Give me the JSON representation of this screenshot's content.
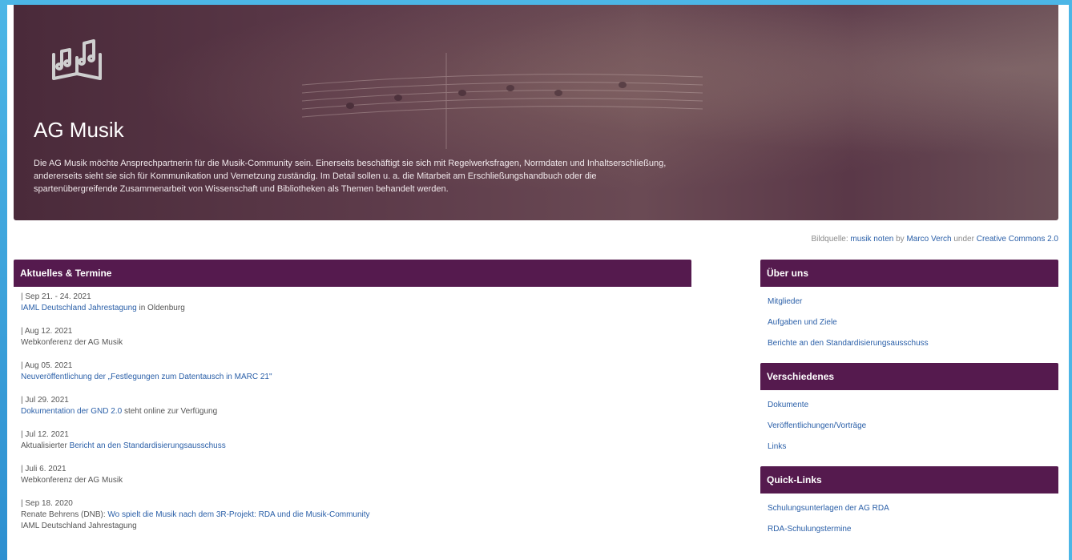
{
  "hero": {
    "title": "AG Musik",
    "description": "Die AG Musik möchte Ansprechpartnerin für die Musik-Community sein. Einerseits beschäftigt sie sich mit Regelwerksfragen, Normdaten und Inhaltserschließung, andererseits sieht sie sich für Kommunikation und Vernetzung zuständig. Im Detail sollen u. a. die Mitarbeit am Erschließungshandbuch oder die spartenübergreifende Zusammenarbeit von Wissenschaft und Bibliotheken als Themen behandelt werden.",
    "logo_icon": "music-book-icon"
  },
  "credit": {
    "prefix": "Bildquelle: ",
    "work": "musik noten",
    "by": " by ",
    "author": "Marco Verch",
    "under": " under ",
    "license": "Creative Commons 2.0"
  },
  "news": {
    "title": "Aktuelles & Termine",
    "items": [
      {
        "date": "| Sep 21. - 24. 2021",
        "pre": "",
        "link": "IAML Deutschland Jahrestagung",
        "post": " in Oldenburg",
        "extra": ""
      },
      {
        "date": "| Aug 12. 2021",
        "pre": "Webkonferenz der AG Musik",
        "link": "",
        "post": "",
        "extra": ""
      },
      {
        "date": "| Aug 05. 2021",
        "pre": "",
        "link": "Neuveröffentlichung der „Festlegungen zum Datentausch in MARC 21\"",
        "post": "",
        "extra": ""
      },
      {
        "date": "| Jul 29. 2021",
        "pre": "",
        "link": "Dokumentation der GND 2.0",
        "post": " steht online zur Verfügung",
        "extra": ""
      },
      {
        "date": "| Jul 12. 2021",
        "pre": "Aktualisierter ",
        "link": "Bericht an den Standardisierungsausschuss",
        "post": "",
        "extra": ""
      },
      {
        "date": "| Juli 6. 2021",
        "pre": "Webkonferenz der AG Musik",
        "link": "",
        "post": "",
        "extra": ""
      },
      {
        "date": "| Sep 18. 2020",
        "pre": "Renate Behrens (DNB): ",
        "link": "Wo spielt die Musik nach dem 3R-Projekt: RDA und die Musik-Community",
        "post": "",
        "extra": "IAML Deutschland Jahrestagung"
      }
    ]
  },
  "about": {
    "title": "Über uns",
    "links": [
      "Mitglieder",
      "Aufgaben und Ziele",
      "Berichte an den Standardisierungsausschuss"
    ]
  },
  "misc": {
    "title": "Verschiedenes",
    "links": [
      "Dokumente",
      "Veröffentlichungen/Vorträge",
      "Links"
    ]
  },
  "quick": {
    "title": "Quick-Links",
    "links": [
      "Schulungsunterlagen der AG RDA",
      "RDA-Schulungstermine"
    ]
  },
  "colors": {
    "panel_header": "#551a4e",
    "link": "#2a5fa8",
    "frame": "#4cb6e6"
  }
}
